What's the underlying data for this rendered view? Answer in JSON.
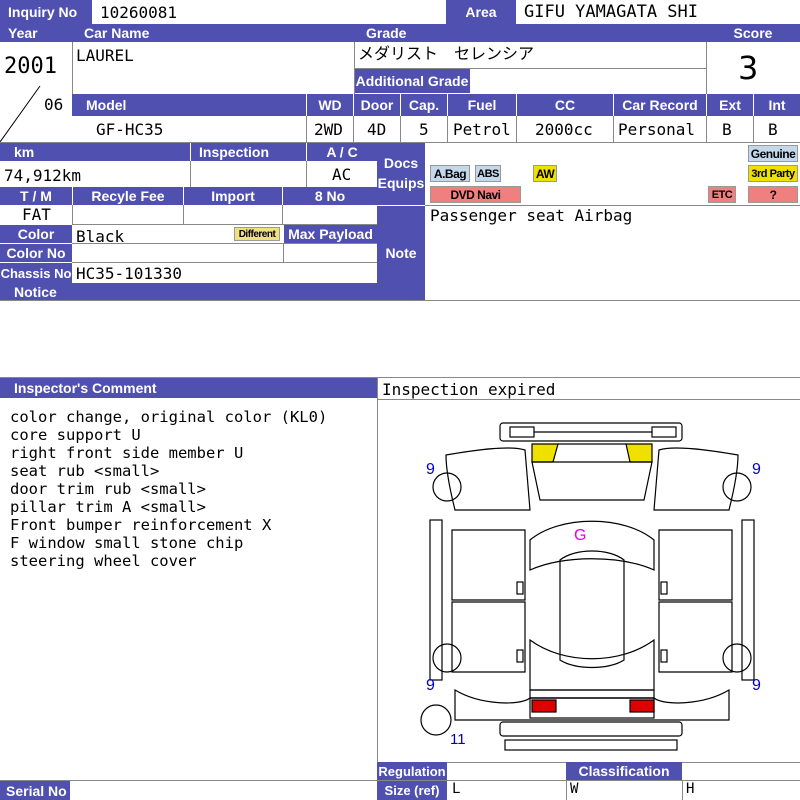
{
  "labels": {
    "inquiry": "Inquiry No",
    "area": "Area",
    "year": "Year",
    "car_name": "Car Name",
    "grade": "Grade",
    "score": "Score",
    "additional_grade": "Additional Grade",
    "model": "Model",
    "wd": "WD",
    "door": "Door",
    "cap": "Cap.",
    "fuel": "Fuel",
    "cc": "CC",
    "car_record": "Car Record",
    "ext": "Ext",
    "int": "Int",
    "km": "km",
    "inspection": "Inspection",
    "ac": "A / C",
    "docs": "Docs",
    "equips": "Equips",
    "tm": "T / M",
    "recycle_fee": "Recyle Fee",
    "import": "Import",
    "eight_no": "8 No",
    "color": "Color",
    "different": "Different",
    "max_payload": "Max Payload",
    "color_no": "Color No",
    "note": "Note",
    "chassis_no": "Chassis No",
    "notice": "Notice",
    "inspectors_comment": "Inspector's Comment",
    "regulation": "Regulation",
    "classification": "Classification",
    "serial_no": "Serial No",
    "size": "Size (ref)",
    "size_l": "L",
    "size_w": "W",
    "size_h": "H"
  },
  "values": {
    "inquiry_no": "10260081",
    "area": "GIFU YAMAGATA SHI",
    "year": "2001",
    "month": "06",
    "car_name": "LAUREL",
    "grade": "メダリスト　セレンシア",
    "score": "3",
    "model": "GF-HC35",
    "wd": "2WD",
    "door": "4D",
    "cap": "5",
    "fuel": "Petrol",
    "cc": "2000cc",
    "car_record": "Personal",
    "ext": "B",
    "int": "B",
    "km": "74,912km",
    "ac": "AC",
    "tm": "FAT",
    "color": "Black",
    "chassis_no": "HC35-101330",
    "note": "Passenger seat Airbag",
    "inspection_status": "Inspection expired"
  },
  "equips": {
    "genuine": "Genuine",
    "abag": "A.Bag",
    "abs": "ABS",
    "aw": "AW",
    "third_party": "3rd Party",
    "dvd_navi": "DVD Navi",
    "etc": "ETC",
    "question": "?"
  },
  "comments": [
    "color change, original color (KL0)",
    "core support U",
    "right front side member U",
    "seat rub <small>",
    "door trim rub <small>",
    "pillar trim A <small>",
    "Front bumper reinforcement X",
    "F window small stone chip",
    "steering wheel cover"
  ],
  "diagram_marks": {
    "roof": "G",
    "tire_fl": "9",
    "tire_fr": "9",
    "tire_rl": "9",
    "tire_rr": "9",
    "spare": "11"
  },
  "colors": {
    "label_bg": "#5050b0",
    "aw_yellow": "#f0e000",
    "red_tag": "#f08080",
    "lamp_red": "#e00000",
    "mark_blue": "#0000cc",
    "mark_magenta": "#e000e0"
  }
}
